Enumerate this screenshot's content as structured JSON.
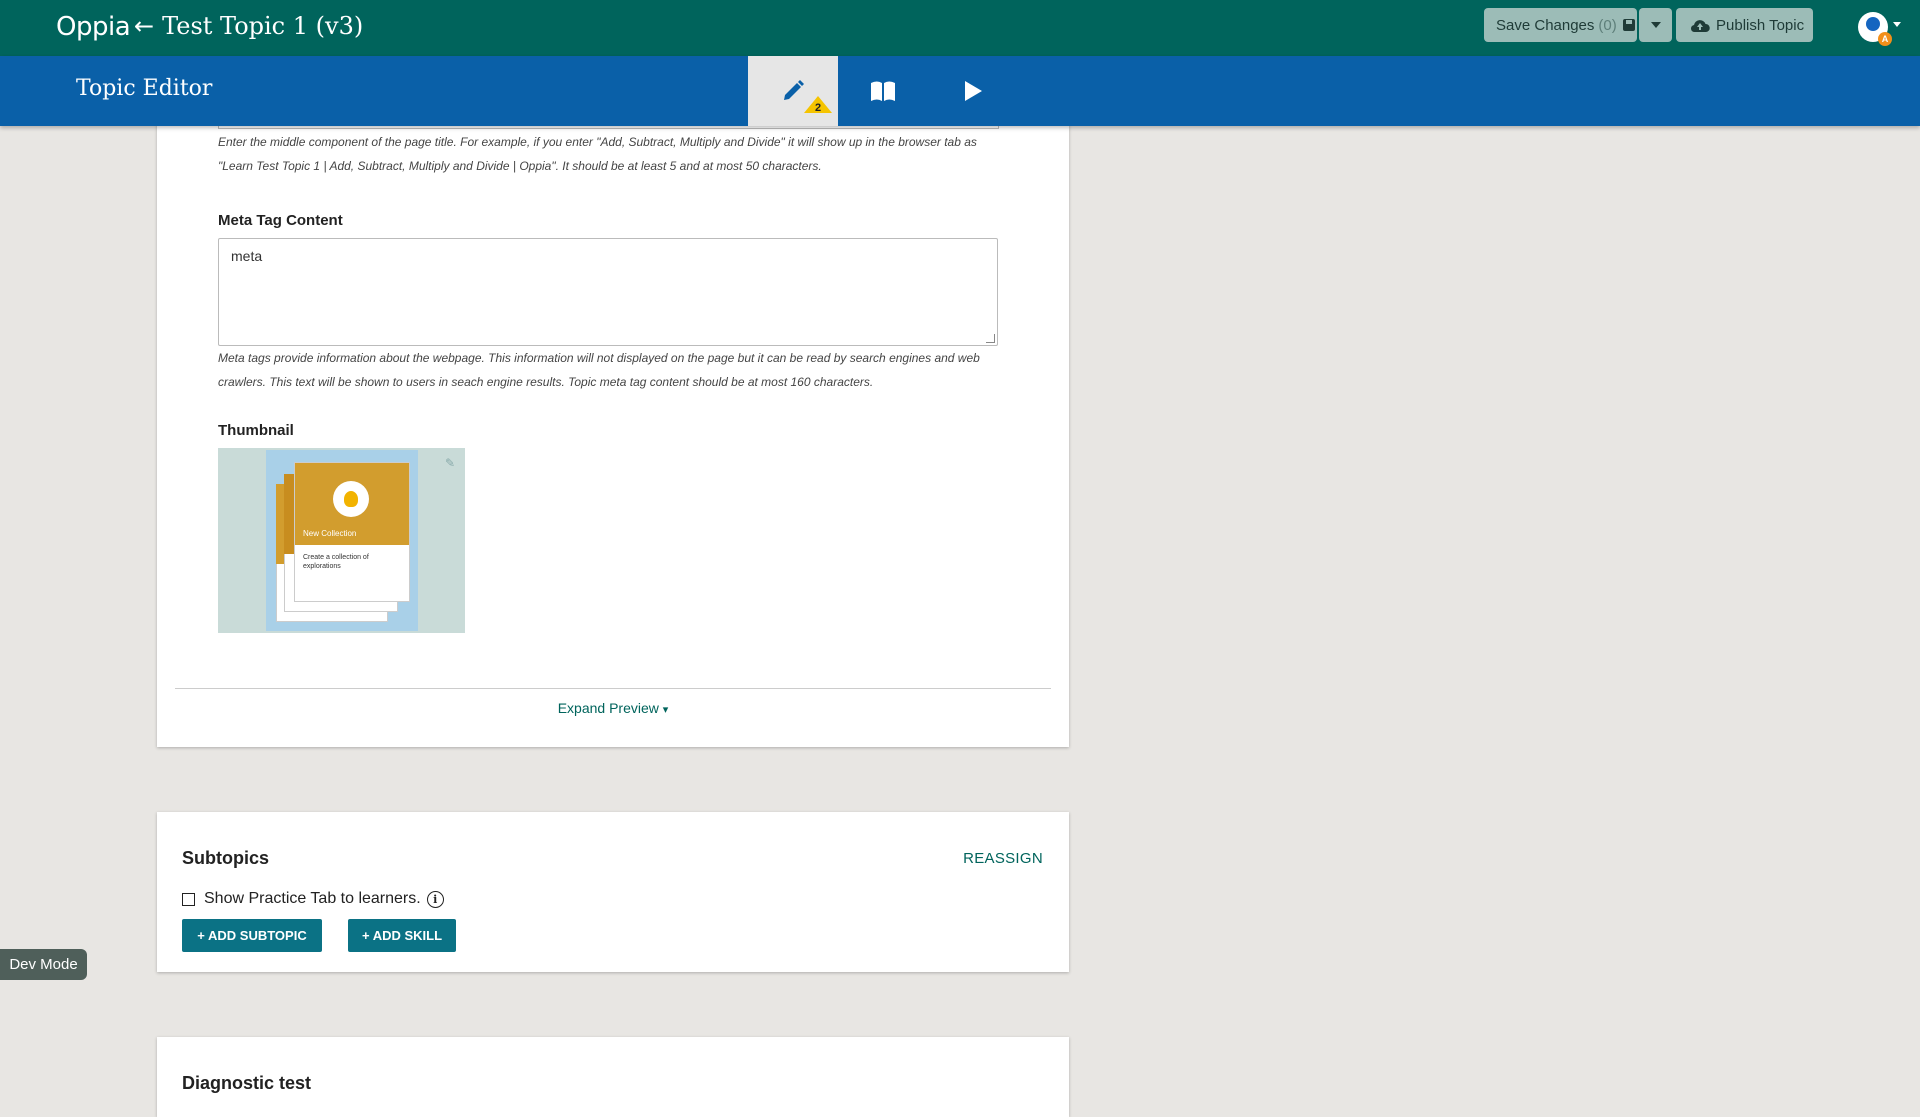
{
  "header": {
    "logo": "Oppia",
    "topic_title": "Test Topic 1 (v3)",
    "save_label": "Save Changes",
    "save_count": "(0)",
    "publish_label": "Publish Topic",
    "avatar_badge": "A"
  },
  "subnav": {
    "title": "Topic Editor",
    "warning_count": "2",
    "tabs": [
      "edit-icon",
      "book-icon",
      "play-icon"
    ]
  },
  "details": {
    "page_title_help": "Enter the middle component of the page title. For example, if you enter \"Add, Subtract, Multiply and Divide\" it will show up in the browser tab as \"Learn Test Topic 1 | Add, Subtract, Multiply and Divide | Oppia\". It should be at least 5 and at most 50 characters.",
    "meta_label": "Meta Tag Content",
    "meta_value": "meta",
    "meta_help": "Meta tags provide information about the webpage. This information will not displayed on the page but it can be read by search engines and web crawlers. This text will be shown to users in seach engine results. Topic meta tag content should be at most 160 characters.",
    "thumbnail_label": "Thumbnail",
    "thumbnail_card_title": "New Collection",
    "thumbnail_card_desc": "Create a collection of explorations",
    "expand_label": "Expand Preview"
  },
  "subtopics": {
    "title": "Subtopics",
    "reassign_label": "REASSIGN",
    "practice_tab_label": "Show Practice Tab to learners.",
    "practice_tab_checked": false,
    "add_subtopic_label": "+ ADD SUBTOPIC",
    "add_skill_label": "+ ADD SKILL"
  },
  "diagnostic": {
    "title": "Diagnostic test"
  },
  "dev_mode_label": "Dev Mode",
  "colors": {
    "topbar": "#00645c",
    "subbar": "#0a60a8",
    "button_teal": "#0b7285",
    "warning": "#f5c400"
  }
}
